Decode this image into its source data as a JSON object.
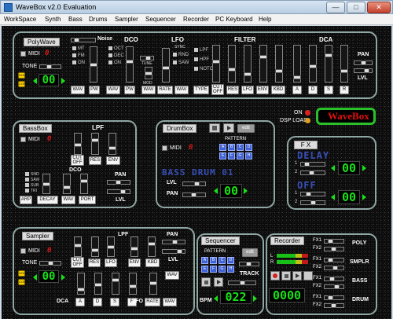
{
  "window": {
    "title": "WaveBox v2.0 Evaluation",
    "minimize": "—",
    "maximize": "□",
    "close": "✕"
  },
  "menu": [
    "WorkSpace",
    "Synth",
    "Bass",
    "Drums",
    "Sampler",
    "Sequencer",
    "Recorder",
    "PC Keyboard",
    "Help"
  ],
  "polywave": {
    "title": "PolyWave",
    "midi": "MIDI",
    "midi_ch": "0",
    "tone": "TONE",
    "tone_value": "00",
    "hold": "HOLD",
    "conti": "CONTI",
    "noise": "Noise",
    "dco": "DCO",
    "dco_modes": [
      "MT",
      "FM",
      "ON"
    ],
    "dco_opts": [
      "OCT",
      "DEC",
      "ON"
    ],
    "tune": "TUNE",
    "mod": "MOD",
    "lfo": "LFO",
    "sync": "SYNC",
    "lfo_opts": [
      "RND",
      "SAW"
    ],
    "filter": "FILTER",
    "filter_types": [
      "LPF",
      "HPF",
      "NOTCH"
    ],
    "dca": "DCA",
    "pan": "PAN",
    "lvl": "LVL",
    "buttons": [
      "WAV",
      "PW",
      "WAV",
      "PW",
      "WAV",
      "RATE",
      "WAV",
      "TYPE",
      "CUT OFF",
      "RES",
      "LFO",
      "ENV",
      "KBD",
      "A",
      "D",
      "S",
      "R"
    ]
  },
  "status": {
    "on": "ON",
    "dsp_load": "DSP LOAD",
    "on_color": "#e02020",
    "dsp_color": "#e0a020"
  },
  "logo": {
    "text": "WaveBox",
    "border_color": "#2bbf2b",
    "text_color": "#e01010"
  },
  "bassbox": {
    "title": "BassBox",
    "midi": "MIDI",
    "midi_ch": "0",
    "lpf": "LPF",
    "dco": "DCO",
    "pan": "PAN",
    "lvl": "LVL",
    "wave_opts": [
      "SND",
      "SAW",
      "SUB",
      "TRI"
    ],
    "buttons": [
      "CUT OFF",
      "RES",
      "ENV",
      "ARP",
      "DECAY",
      "WAV",
      "PORT"
    ]
  },
  "drumbox": {
    "title": "DrumBox",
    "edit": "edit",
    "pattern": "PATTERN",
    "midi": "MIDI",
    "midi_ch": "0",
    "patterns": [
      "A",
      "B",
      "C",
      "D",
      "E",
      "F",
      "G",
      "H"
    ],
    "kit_display": "BASS DRUM 01",
    "lvl": "LVL",
    "pan": "PAN",
    "kit_value": "00"
  },
  "fx": {
    "title": "F X",
    "delay": "DELAY",
    "delay_value": "00",
    "off": "OFF",
    "off_value": "00",
    "delay_rows": [
      "1",
      "2"
    ],
    "off_rows": [
      "1",
      "2"
    ]
  },
  "sampler": {
    "title": "Sampler",
    "midi": "MIDI",
    "midi_ch": "0",
    "tone": "TONE",
    "tone_value": "00",
    "hold": "HOLD",
    "conti": "CONTI",
    "lpf": "LPF",
    "dca": "DCA",
    "lfo": "LFO",
    "pan": "PAN",
    "lvl": "LVL",
    "buttons": [
      "CUT OFF",
      "RES",
      "LFO",
      "ENV",
      "KBD",
      "WAV",
      "A",
      "D",
      "S",
      "R",
      "RATE",
      "WAV"
    ]
  },
  "sequencer": {
    "title": "Sequencer",
    "edit": "edit",
    "pattern": "PATTERN",
    "patterns": [
      "A",
      "B",
      "C",
      "D",
      "E",
      "F",
      "G",
      "H"
    ],
    "track": "TRACK",
    "bpm": "BPM",
    "bpm_value": "022"
  },
  "recorder": {
    "title": "Recorder",
    "time_value": "0000",
    "l": "L",
    "r": "R",
    "fx_labels": [
      "FX1",
      "FX2",
      "FX1",
      "FX2",
      "FX1",
      "FX2",
      "FX1",
      "FX2"
    ],
    "channels": [
      "POLY",
      "SMPLR",
      "BASS",
      "DRUM"
    ]
  }
}
